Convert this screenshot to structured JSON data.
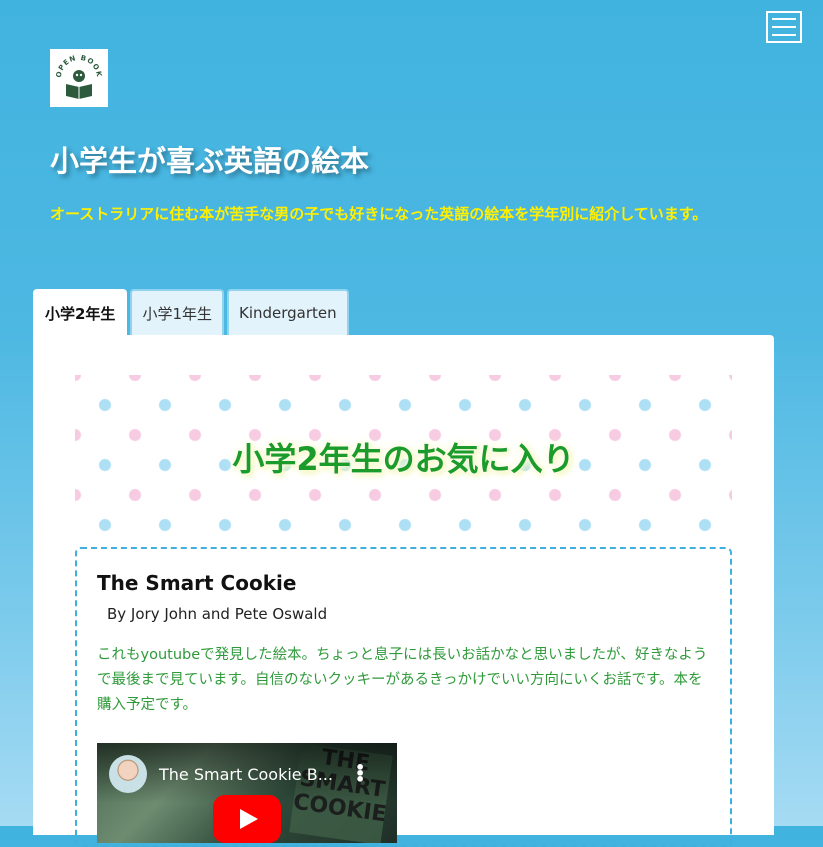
{
  "header": {
    "logo_text": "OPEN BOOK",
    "site_title": "小学生が喜ぶ英語の絵本",
    "site_description": "オーストラリアに住む本が苦手な男の子でも好きになった英語の絵本を学年別に紹介しています。"
  },
  "tabs": [
    {
      "label": "小学2年生",
      "active": true
    },
    {
      "label": "小学1年生",
      "active": false
    },
    {
      "label": "Kindergarten",
      "active": false
    }
  ],
  "hero": {
    "heading": "小学2年生のお気に入り"
  },
  "book": {
    "title": "The Smart Cookie",
    "authors": "By Jory John and Pete Oswald",
    "description": "これもyoutubeで発見した絵本。ちょっと息子には長いお話かなと思いましたが、好きなようで最後まで見ています。自信のないクッキーがあるきっかけでいい方向にいくお話です。本を購入予定です。",
    "video_title": "The Smart Cookie B...",
    "video_art_text": "THE SMART COOKIE"
  },
  "colors": {
    "background_top": "#41b3df",
    "title_yellow": "#fff000",
    "hero_green": "#1a9b2a",
    "text_green": "#2f9a3a",
    "dashed_border": "#3fb0dc",
    "youtube_red": "#ff0000"
  },
  "icons": {
    "menu": "hamburger-icon",
    "video_menu": "more-vertical-icon",
    "play": "youtube-play-icon"
  }
}
